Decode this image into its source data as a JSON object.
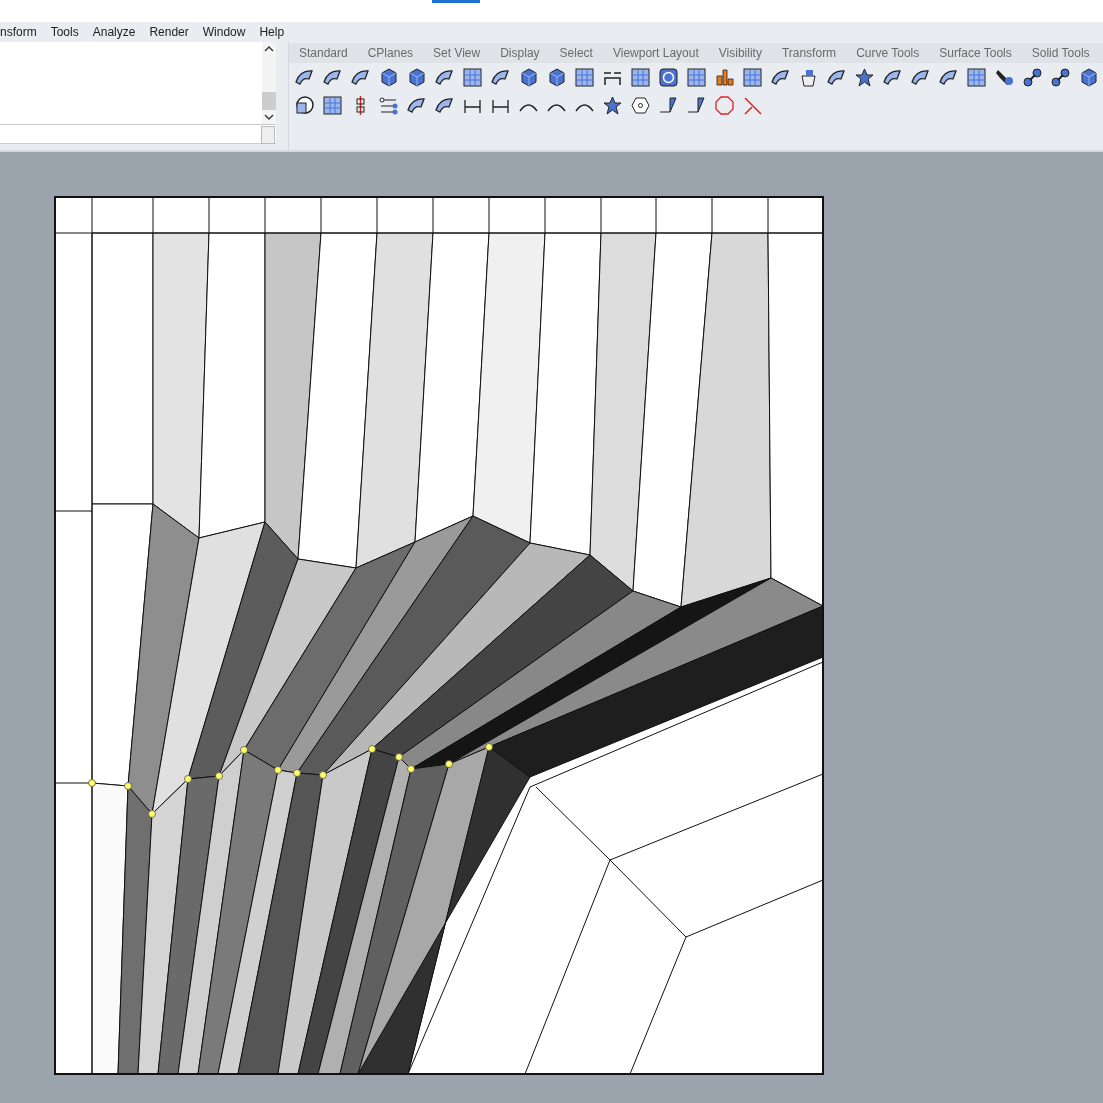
{
  "menu": {
    "items": [
      {
        "label": "nsform"
      },
      {
        "label": "Tools"
      },
      {
        "label": "Analyze"
      },
      {
        "label": "Render"
      },
      {
        "label": "Window"
      },
      {
        "label": "Help"
      }
    ]
  },
  "toolbar": {
    "tabs": [
      {
        "label": "Standard"
      },
      {
        "label": "CPlanes"
      },
      {
        "label": "Set View"
      },
      {
        "label": "Display"
      },
      {
        "label": "Select"
      },
      {
        "label": "Viewport Layout"
      },
      {
        "label": "Visibility"
      },
      {
        "label": "Transform"
      },
      {
        "label": "Curve Tools"
      },
      {
        "label": "Surface Tools"
      },
      {
        "label": "Solid Tools"
      }
    ]
  }
}
